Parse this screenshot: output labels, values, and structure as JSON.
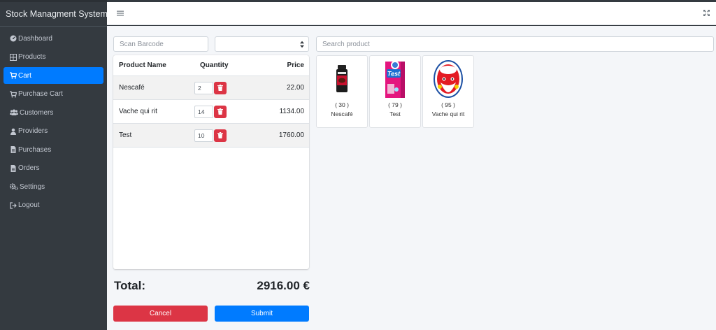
{
  "app": {
    "title": "Stock Managment System"
  },
  "sidebar": {
    "items": [
      {
        "label": "Dashboard",
        "icon": "gauge-icon"
      },
      {
        "label": "Products",
        "icon": "grid-icon"
      },
      {
        "label": "Cart",
        "icon": "cart-icon",
        "active": true
      },
      {
        "label": "Purchase Cart",
        "icon": "cart-icon"
      },
      {
        "label": "Customers",
        "icon": "users-icon"
      },
      {
        "label": "Providers",
        "icon": "user-icon"
      },
      {
        "label": "Purchases",
        "icon": "file-icon"
      },
      {
        "label": "Orders",
        "icon": "file-icon"
      },
      {
        "label": "Settings",
        "icon": "gears-icon"
      },
      {
        "label": "Logout",
        "icon": "sign-out-icon"
      }
    ]
  },
  "controls": {
    "barcode_placeholder": "Scan Barcode",
    "customer_select_value": "",
    "search_placeholder": "Search product"
  },
  "cart": {
    "headers": {
      "name": "Product Name",
      "quantity": "Quantity",
      "price": "Price"
    },
    "rows": [
      {
        "name": "Nescafé",
        "quantity": "2",
        "price": "22.00"
      },
      {
        "name": "Vache qui rit",
        "quantity": "14",
        "price": "1134.00"
      },
      {
        "name": "Test",
        "quantity": "10",
        "price": "1760.00"
      }
    ],
    "total_label": "Total:",
    "total_value": "2916.00 €"
  },
  "buttons": {
    "cancel": "Cancel",
    "submit": "Submit"
  },
  "products": [
    {
      "stock": "( 30 )",
      "name": "Nescafé"
    },
    {
      "stock": "( 79 )",
      "name": "Test"
    },
    {
      "stock": "( 95 )",
      "name": "Vache qui rit"
    }
  ],
  "colors": {
    "primary": "#007bff",
    "danger": "#dc3545",
    "sidebar": "#343a40"
  }
}
